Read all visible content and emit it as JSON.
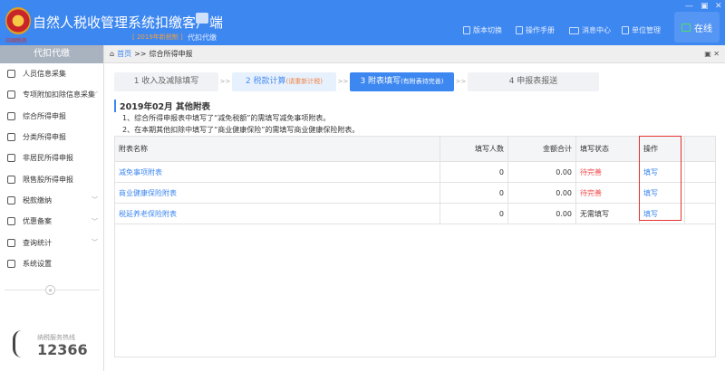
{
  "header": {
    "app_title": "自然人税收管理系统扣缴客户端",
    "subtitle": "[ 2019年新税制 ]",
    "logo_text": "中国税务",
    "module": "代扣代缴",
    "tools": [
      {
        "label": "版本切换",
        "icon": "document-icon"
      },
      {
        "label": "操作手册",
        "icon": "manual-icon"
      },
      {
        "label": "消息中心",
        "icon": "mail-icon"
      },
      {
        "label": "单位管理",
        "icon": "building-icon"
      }
    ],
    "online": "在线",
    "window_controls": [
      "—",
      "▣",
      "✕"
    ]
  },
  "sidebar": {
    "title": "代扣代缴",
    "items": [
      {
        "label": "人员信息采集",
        "icon": "person-icon",
        "expandable": false
      },
      {
        "label": "专项附加扣除信息采集",
        "icon": "list-icon",
        "expandable": true
      },
      {
        "label": "综合所得申报",
        "icon": "layers-icon",
        "expandable": false
      },
      {
        "label": "分类所得申报",
        "icon": "pie-chart-icon",
        "expandable": false
      },
      {
        "label": "非居民所得申报",
        "icon": "user-icon",
        "expandable": false
      },
      {
        "label": "限售股所得申报",
        "icon": "bar-chart-icon",
        "expandable": false
      },
      {
        "label": "税款缴纳",
        "icon": "folder-icon",
        "expandable": true
      },
      {
        "label": "优惠备案",
        "icon": "file-icon",
        "expandable": true
      },
      {
        "label": "查询统计",
        "icon": "search-list-icon",
        "expandable": true
      },
      {
        "label": "系统设置",
        "icon": "gear-icon",
        "expandable": false
      }
    ],
    "collapse": "«",
    "hotline_label": "纳税服务热线",
    "hotline": "12366"
  },
  "breadcrumb": {
    "home": "首页",
    "sep": ">>",
    "current": "综合所得申报",
    "controls": "▣ ✕"
  },
  "steps": [
    {
      "label": "1 收入及减除填写",
      "note": ""
    },
    {
      "label": "2 税款计算",
      "note": "(请重新计税)"
    },
    {
      "label": "3 附表填写",
      "note": "(有附表待完善)"
    },
    {
      "label": "4 申报表报送",
      "note": ""
    }
  ],
  "step_sep": ">>",
  "section_title": "2019年02月  其他附表",
  "notes": [
    "1、综合所得申报表中填写了“减免税额”的需填写减免事项附表。",
    "2、在本期其他扣除中填写了“商业健康保险”的需填写商业健康保险附表。"
  ],
  "table": {
    "headers": [
      "附表名称",
      "填写人数",
      "金额合计",
      "填写状态",
      "操作"
    ],
    "rows": [
      {
        "name": "减免事项附表",
        "count": "0",
        "amount": "0.00",
        "status": "待完善",
        "status_color": "#f05050",
        "action": "填写"
      },
      {
        "name": "商业健康保险附表",
        "count": "0",
        "amount": "0.00",
        "status": "待完善",
        "status_color": "#f05050",
        "action": "填写"
      },
      {
        "name": "税延养老保险附表",
        "count": "0",
        "amount": "0.00",
        "status": "无需填写",
        "status_color": "#333333",
        "action": "填写"
      }
    ]
  },
  "colors": {
    "brand": "#3d87f0",
    "highlight": "#e53030"
  }
}
